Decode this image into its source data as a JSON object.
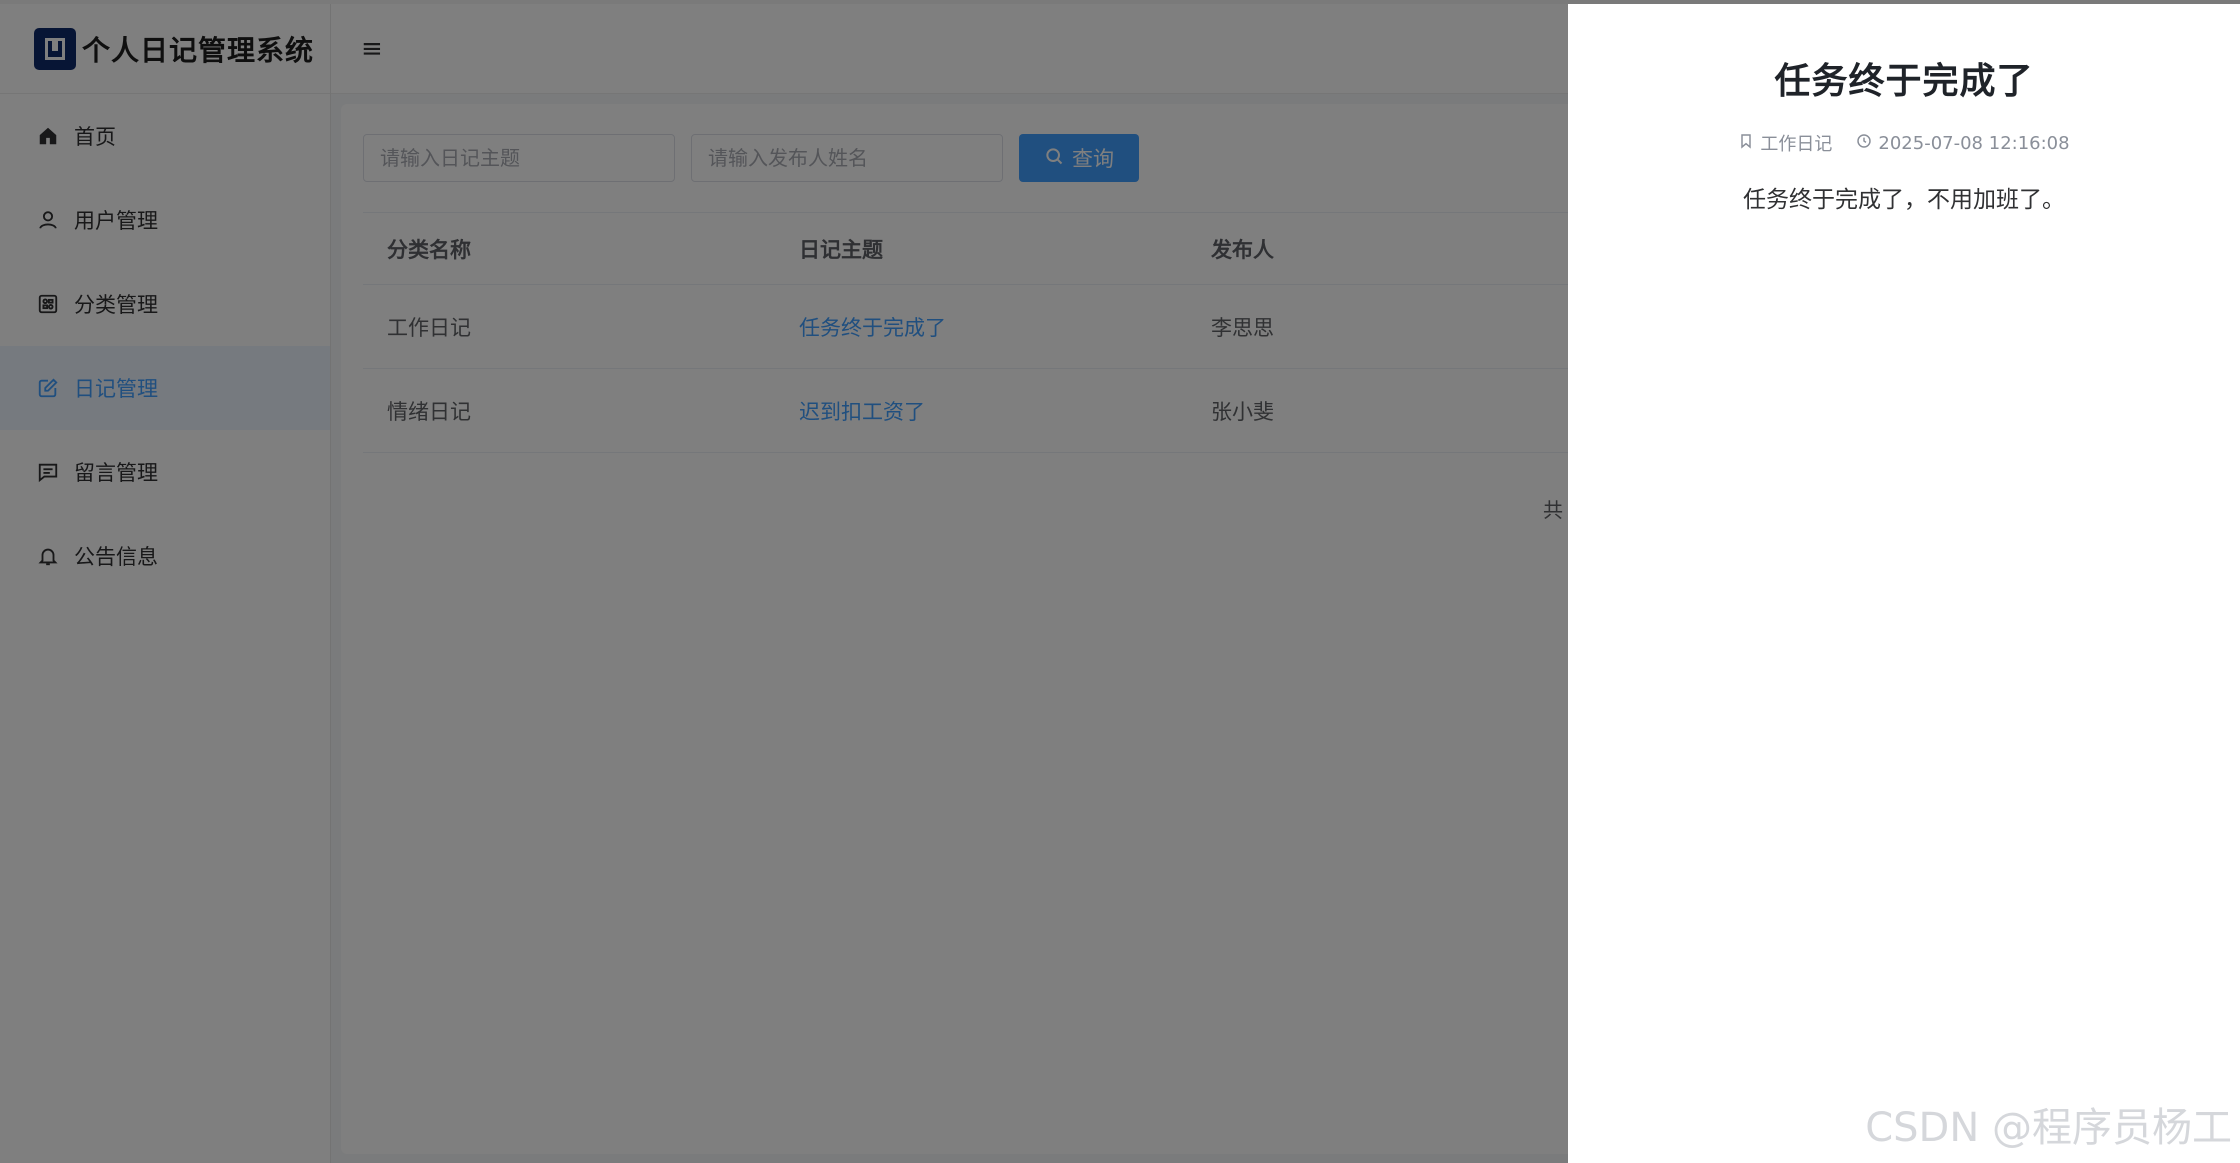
{
  "app": {
    "title": "个人日记管理系统"
  },
  "sidebar": {
    "items": [
      {
        "label": "首页",
        "icon": "home-icon"
      },
      {
        "label": "用户管理",
        "icon": "user-icon"
      },
      {
        "label": "分类管理",
        "icon": "category-icon"
      },
      {
        "label": "日记管理",
        "icon": "edit-icon",
        "active": true
      },
      {
        "label": "留言管理",
        "icon": "message-icon"
      },
      {
        "label": "公告信息",
        "icon": "bell-icon"
      }
    ]
  },
  "header": {
    "menu_toggle_icon": "hamburger-icon"
  },
  "search": {
    "title_placeholder": "请输入日记主题",
    "author_placeholder": "请输入发布人姓名",
    "button_label": "查询"
  },
  "table": {
    "columns": [
      "分类名称",
      "日记主题",
      "发布人"
    ],
    "rows": [
      [
        "工作日记",
        "任务终于完成了",
        "李思思"
      ],
      [
        "情绪日记",
        "迟到扣工资了",
        "张小斐"
      ]
    ]
  },
  "pagination": {
    "total_prefix": "共"
  },
  "drawer": {
    "title": "任务终于完成了",
    "category": "工作日记",
    "time": "2025-07-08 12:16:08",
    "content": "任务终于完成了，不用加班了。"
  },
  "watermark": "CSDN @程序员杨工",
  "colors": {
    "primary": "#409eff",
    "active_bg": "#ecf5ff",
    "logo_bg": "#0f2a6b"
  }
}
